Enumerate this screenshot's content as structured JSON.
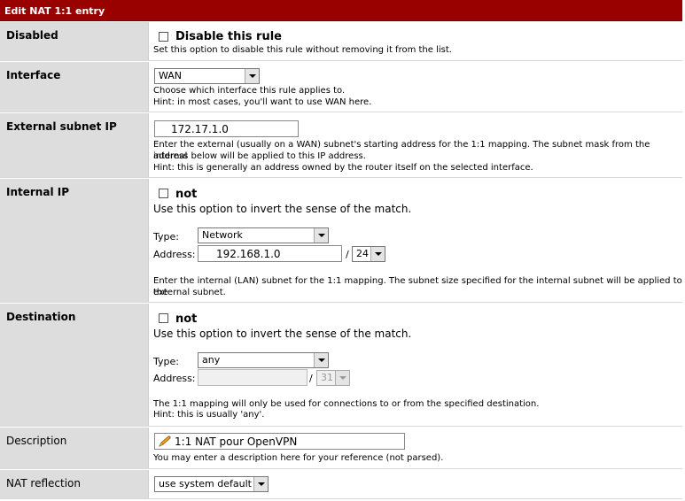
{
  "header": {
    "title": "Edit NAT 1:1 entry"
  },
  "disabled": {
    "label": "Disabled",
    "checkbox_label": "Disable this rule",
    "hint": "Set this option to disable this rule without removing it from the list."
  },
  "interface": {
    "label": "Interface",
    "selected": "WAN",
    "hint1": "Choose which interface this rule applies to.",
    "hint2": "Hint: in most cases, you'll want to use WAN here."
  },
  "external": {
    "label": "External subnet IP",
    "value": "172.17.1.0",
    "hint1": "Enter the external (usually on a WAN) subnet's starting address for the 1:1 mapping. The subnet mask from the internal",
    "hint2": "address below will be applied to this IP address.",
    "hint3": "Hint: this is generally an address owned by the router itself on the selected interface."
  },
  "internal": {
    "label": "Internal IP",
    "not_label": "not",
    "invert_hint": "Use this option to invert the sense of the match.",
    "type_label": "Type:",
    "type_value": "Network",
    "address_label": "Address:",
    "address_value": "192.168.1.0",
    "slash": "/",
    "mask_value": "24",
    "hint1": "Enter the internal (LAN) subnet for the 1:1 mapping. The subnet size specified for the internal subnet will be applied to the",
    "hint2": "external subnet."
  },
  "destination": {
    "label": "Destination",
    "not_label": "not",
    "invert_hint": "Use this option to invert the sense of the match.",
    "type_label": "Type:",
    "type_value": "any",
    "address_label": "Address:",
    "address_value": "",
    "slash": "/",
    "mask_value": "31",
    "hint1": "The 1:1 mapping will only be used for connections to or from the specified destination.",
    "hint2": "Hint: this is usually 'any'."
  },
  "description": {
    "label": "Description",
    "value": "1:1 NAT pour OpenVPN",
    "hint": "You may enter a description here for your reference (not parsed)."
  },
  "nat_reflection": {
    "label": "NAT reflection",
    "selected": "use system default"
  },
  "icons": {
    "description_field": "pencil-icon"
  }
}
